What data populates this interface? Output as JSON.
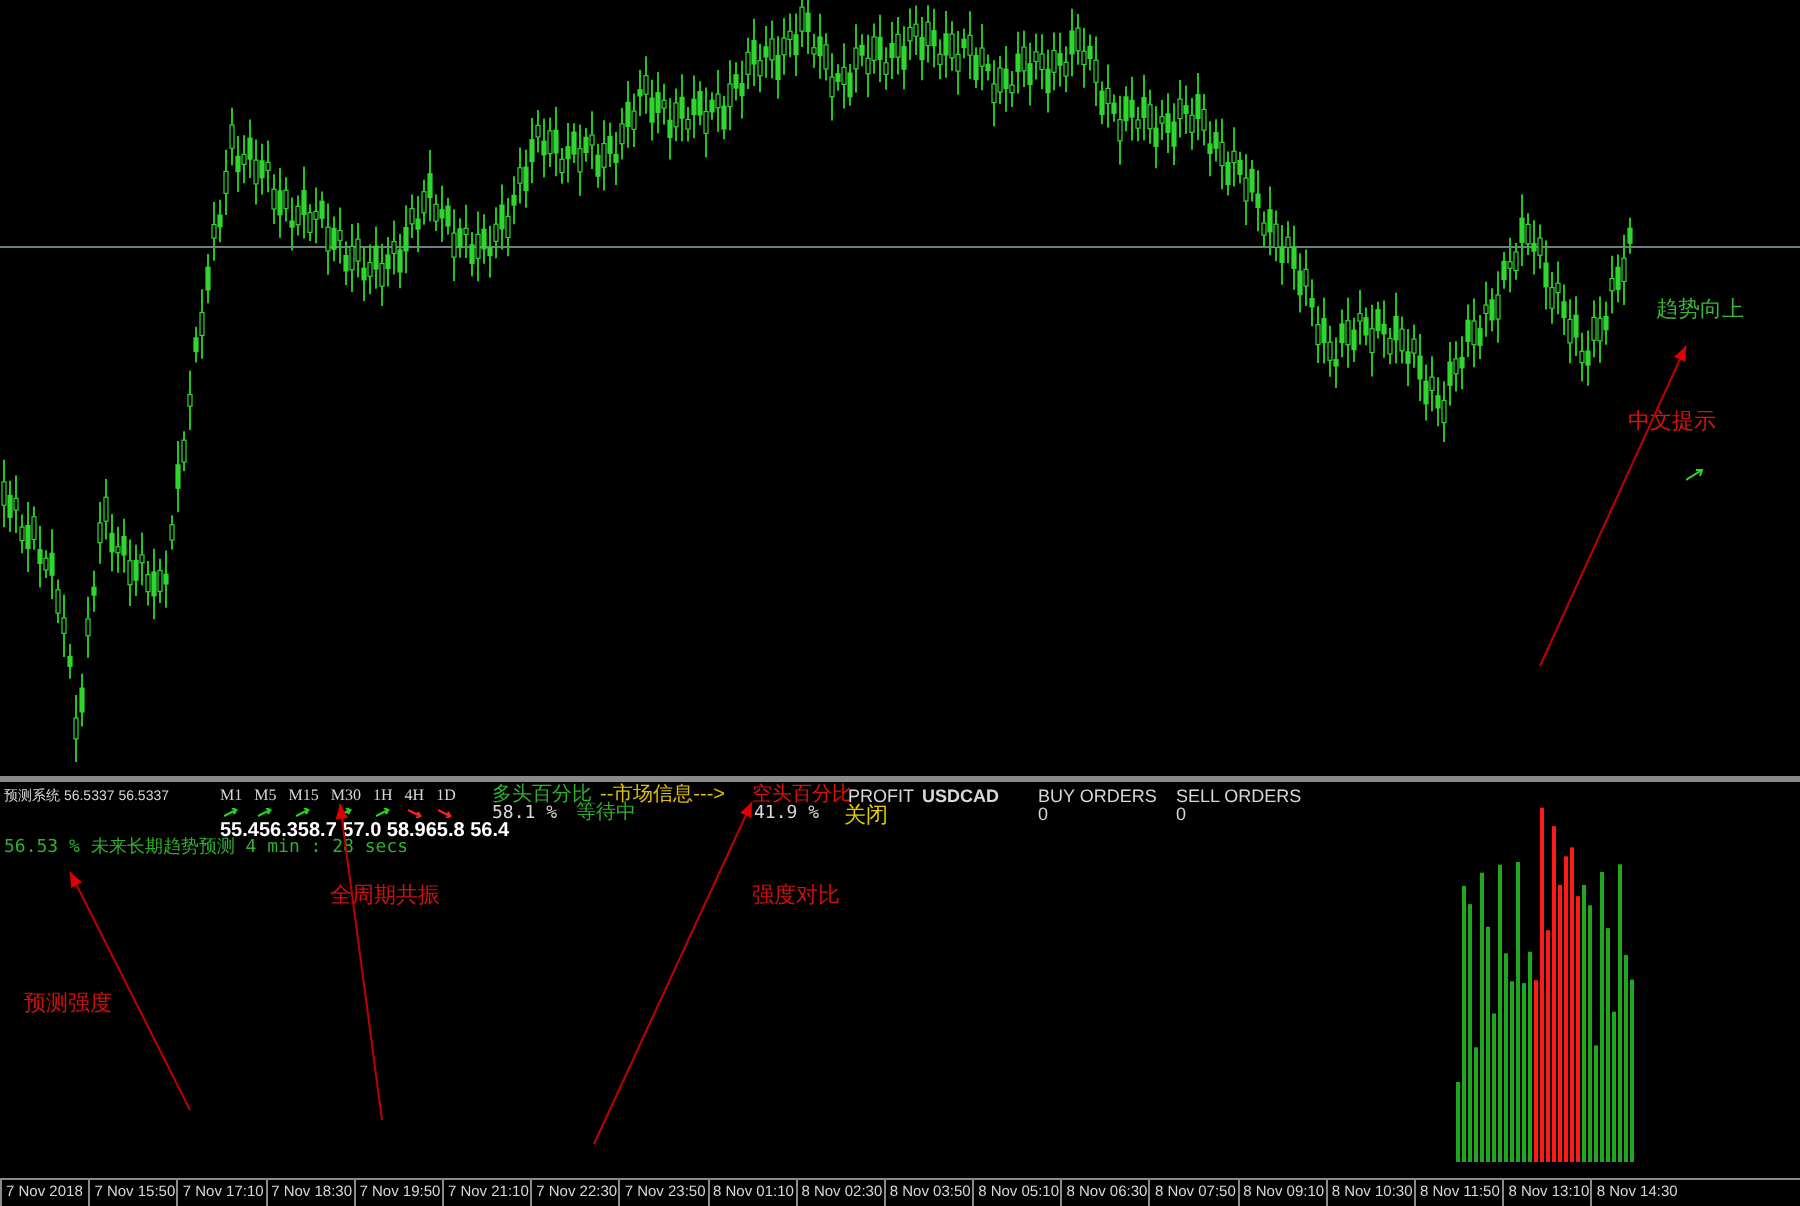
{
  "main_chart": {
    "annotations": [
      {
        "text": "趋势向上",
        "color": "#3cb43c"
      },
      {
        "text": "中文提示",
        "color": "#e01010"
      }
    ]
  },
  "indicator_panel": {
    "title": "预测系统 56.5337 56.5337",
    "timeframes": [
      {
        "label": "M1",
        "bullish": true
      },
      {
        "label": "M5",
        "bullish": true
      },
      {
        "label": "M15",
        "bullish": true
      },
      {
        "label": "M30",
        "bullish": true
      },
      {
        "label": "1H",
        "bullish": true
      },
      {
        "label": "4H",
        "bullish": false
      },
      {
        "label": "1D",
        "bullish": false
      }
    ],
    "values": "55.456.358.7 57.0 58.965.8 56.4",
    "bull_label": "多头百分比",
    "market_info": "--市场信息--->",
    "bull_value": "58.1 %",
    "status": "等待中",
    "bear_label": "空头百分比",
    "bear_value": "41.9 %",
    "profit_label": "PROFIT",
    "profit_state": "关闭",
    "symbol": "USDCAD",
    "buy_orders": {
      "label": "BUY ORDERS",
      "value": "0"
    },
    "sell_orders": {
      "label": "SELL ORDERS",
      "value": "0"
    },
    "forecast": "56.53 % 未来长期趋势预测 4 min : 28 secs",
    "annotations": [
      "全周期共振",
      "强度对比",
      "预测强度"
    ]
  },
  "time_axis": [
    "7 Nov 2018",
    "7 Nov 15:50",
    "7 Nov 17:10",
    "7 Nov 18:30",
    "7 Nov 19:50",
    "7 Nov 21:10",
    "7 Nov 22:30",
    "7 Nov 23:50",
    "8 Nov 01:10",
    "8 Nov 02:30",
    "8 Nov 03:50",
    "8 Nov 05:10",
    "8 Nov 06:30",
    "8 Nov 07:50",
    "8 Nov 09:10",
    "8 Nov 10:30",
    "8 Nov 11:50",
    "8 Nov 13:10",
    "8 Nov 14:30"
  ]
}
